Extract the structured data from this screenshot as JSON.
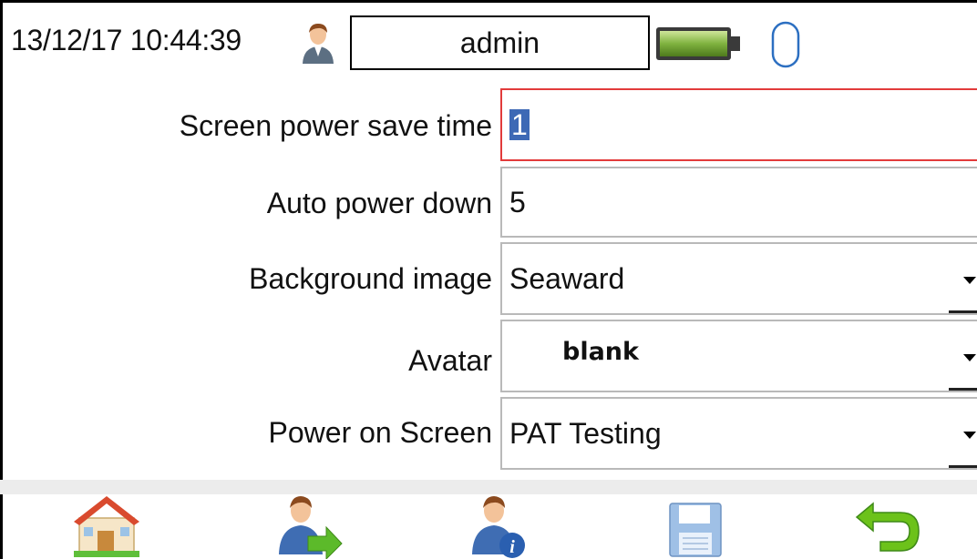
{
  "status_bar": {
    "datetime": "13/12/17 10:44:39",
    "username": "admin",
    "user_icon": "user-avatar-icon",
    "battery_icon": "battery-icon",
    "mouse_icon": "mouse-icon"
  },
  "settings": [
    {
      "label": "Screen power save time",
      "value": "1",
      "type": "text",
      "active": true
    },
    {
      "label": "Auto power down",
      "value": "5",
      "type": "text"
    },
    {
      "label": "Background image",
      "value": "Seaward",
      "type": "select"
    },
    {
      "label": "Avatar",
      "value": "blank",
      "type": "select"
    },
    {
      "label": "Power on Screen",
      "value": "PAT Testing",
      "type": "select"
    }
  ],
  "toolbar": {
    "icons": [
      "home-icon",
      "user-export-icon",
      "user-info-icon",
      "save-icon",
      "back-icon"
    ]
  },
  "colors": {
    "active_border": "#e23b3b",
    "field_border": "#b9b9b9",
    "selection": "#3d69b5",
    "battery_green": "#7fb23f",
    "back_green": "#6cc21a"
  }
}
